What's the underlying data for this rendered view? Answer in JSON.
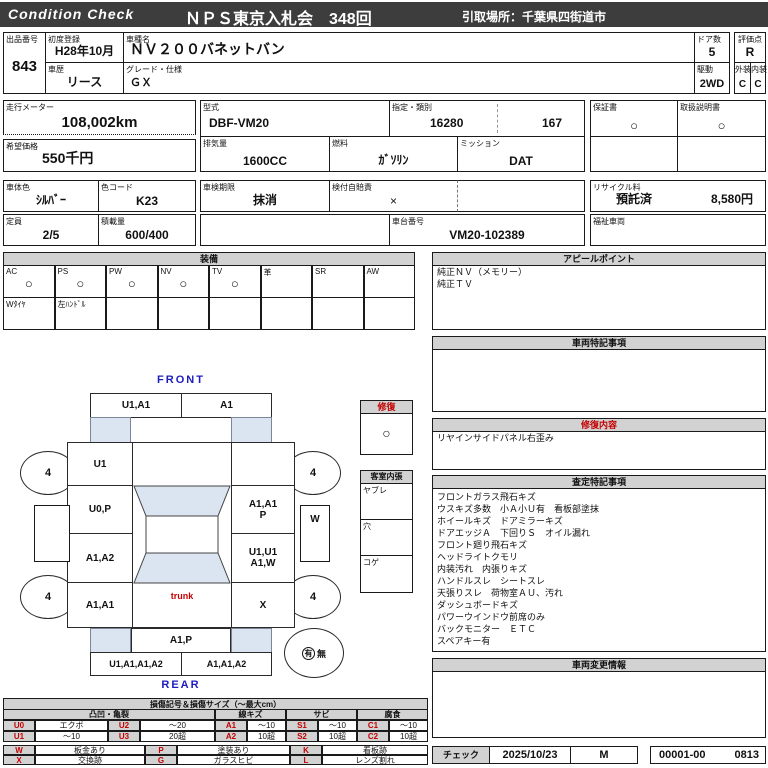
{
  "colors": {
    "bar_dark": "#3d3d3d",
    "panel_gray": "#d2d2d2",
    "accent_red": "#c40000",
    "label_blue": "#1c1cbe",
    "glass_blue": "#dbe5f1"
  },
  "header": {
    "brand": "Condition Check",
    "title": "ＮＰＳ東京入札会　348回",
    "pickup": "引取場所：千葉県四街道市"
  },
  "info": {
    "lot": {
      "label": "出品番号",
      "value": "843"
    },
    "first_reg": {
      "label": "初度登録",
      "value": "H28年10月"
    },
    "history": {
      "label": "車歴",
      "value": "リース"
    },
    "model": {
      "label": "車種名",
      "value": "ＮＶ２００バネットバン"
    },
    "grade": {
      "label": "グレード・仕様",
      "value": "ＧＸ"
    },
    "doors": {
      "label": "ドア数",
      "value": "5"
    },
    "drive": {
      "label": "駆動",
      "value": "2WD"
    },
    "score": {
      "label": "評価点",
      "value": "R"
    },
    "exterior": {
      "label": "外装",
      "value": "C"
    },
    "interior": {
      "label": "内装",
      "value": "C"
    }
  },
  "specs": {
    "odometer": {
      "label": "走行メーター",
      "value": "108,002km"
    },
    "price": {
      "label": "希望価格",
      "value": "550千円"
    },
    "model_code": {
      "label": "型式",
      "value": "DBF-VM20"
    },
    "class": {
      "label": "指定・類別",
      "value1": "16280",
      "value2": "167"
    },
    "displacement": {
      "label": "排気量",
      "value": "1600CC"
    },
    "fuel": {
      "label": "燃料",
      "value": "ｶﾞｿﾘﾝ"
    },
    "mission": {
      "label": "ミッション",
      "value": "DAT"
    },
    "warranty": {
      "label": "保証書",
      "value": "○"
    },
    "manual": {
      "label": "取扱説明書",
      "value": "○"
    },
    "body_color": {
      "label": "車体色",
      "value": "ｼﾙﾊﾞｰ"
    },
    "color_code": {
      "label": "色コード",
      "value": "K23"
    },
    "inspection": {
      "label": "車検期限",
      "value": "抹消"
    },
    "insurance": {
      "label": "検付自賠責",
      "value": "×"
    },
    "recycle": {
      "label": "リサイクル料",
      "status": "預託済",
      "fee": "8,580円"
    },
    "capacity": {
      "label": "定員",
      "value": "2/5"
    },
    "load": {
      "label": "積載量",
      "value": "600/400"
    },
    "chassis": {
      "label": "車台番号",
      "value": "VM20-102389"
    },
    "welfare": {
      "label": "福祉車両",
      "value": ""
    }
  },
  "equipment": {
    "title": "装備",
    "items": [
      {
        "label": "AC",
        "mark": "○"
      },
      {
        "label": "PS",
        "mark": "○"
      },
      {
        "label": "PW",
        "mark": "○"
      },
      {
        "label": "NV",
        "mark": "○"
      },
      {
        "label": "TV",
        "mark": "○"
      },
      {
        "label": "革",
        "mark": ""
      },
      {
        "label": "SR",
        "mark": ""
      },
      {
        "label": "AW",
        "mark": ""
      }
    ],
    "notes": [
      "Wﾀｲﾔ",
      "左ﾊﾝﾄﾞﾙ",
      "",
      "",
      "",
      "",
      "",
      ""
    ]
  },
  "appeal": {
    "title": "アピールポイント",
    "lines": [
      "純正ＮＶ（メモリー）",
      "純正ＴＶ"
    ]
  },
  "vehicle_notes": {
    "title": "車両特記事項"
  },
  "repair": {
    "title": "修復内容",
    "lines": [
      "リヤインサイドパネル右歪み"
    ]
  },
  "assessment": {
    "title": "査定特記事項",
    "lines": [
      "フロントガラス飛石キズ",
      "ウスキズ多数　小Ａ小Ｕ有　看板部塗抹",
      "ホイールキズ　ドアミラーキズ",
      "ドアエッジＡ　下回りＳ　オイル漏れ",
      "フロント廻り飛石キズ",
      "ヘッドライトクモリ",
      "内装汚れ　内張りキズ",
      "ハンドルスレ　シートスレ",
      "天張りスレ　荷物室ＡＵ、汚れ",
      "ダッシュボードキズ",
      "パワーウインドウ前席のみ",
      "バックモニター　ＥＴＣ",
      "スペアキー有"
    ]
  },
  "change_info": {
    "title": "車両変更情報"
  },
  "check": {
    "label": "チェック",
    "date": "2025/10/23",
    "inspector": "M",
    "number": "00001-00",
    "code": "0813"
  },
  "diagram": {
    "front_label": "FRONT",
    "rear_label": "REAR",
    "trunk_label": "trunk",
    "front_bumper_left": "U1,A1",
    "front_bumper_right": "A1",
    "left_fender": "U1",
    "right_fender": "",
    "left_front_door": "U0,P",
    "right_front_door_line1": "A1,A1",
    "right_front_door_line2": "P",
    "left_slide_door": "A1,A2",
    "right_slide_door_line1": "U1,U1",
    "right_slide_door_line2": "A1,W",
    "left_quarter": "A1,A1",
    "right_quarter": "X",
    "rear_gate": "A1,P",
    "rear_bumper_left": "U1,A1,A1,A2",
    "rear_bumper_right": "A1,A1,A2",
    "tire_depths": [
      "4",
      "4",
      "4",
      "4"
    ],
    "side_mark": "W",
    "spare": {
      "present": "有",
      "absent": "無"
    },
    "repair_box": {
      "title": "修復",
      "mark": "○"
    },
    "interior_box": {
      "title": "客室内張",
      "rows": [
        "ヤブレ",
        "穴",
        "コゲ"
      ]
    }
  },
  "legend": {
    "title": "損傷記号＆損傷サイズ（～最大cm）",
    "groups": [
      "凸凹・亀裂",
      "線キズ",
      "サビ",
      "腐食"
    ],
    "rows": [
      [
        {
          "c": "U0",
          "v": "エクボ"
        },
        {
          "c": "U2",
          "v": "～20"
        },
        {
          "c": "A1",
          "v": "～10"
        },
        {
          "c": "S1",
          "v": "～10"
        },
        {
          "c": "C1",
          "v": "～10"
        }
      ],
      [
        {
          "c": "U1",
          "v": "～10"
        },
        {
          "c": "U3",
          "v": "20超"
        },
        {
          "c": "A2",
          "v": "10超"
        },
        {
          "c": "S2",
          "v": "10超"
        },
        {
          "c": "C2",
          "v": "10超"
        }
      ]
    ],
    "marks": [
      [
        {
          "c": "W",
          "v": "板金あり"
        },
        {
          "c": "P",
          "v": "塗装あり"
        },
        {
          "c": "K",
          "v": "看板跡"
        }
      ],
      [
        {
          "c": "X",
          "v": "交換跡"
        },
        {
          "c": "G",
          "v": "ガラスヒビ"
        },
        {
          "c": "L",
          "v": "レンズ割れ"
        }
      ]
    ]
  }
}
